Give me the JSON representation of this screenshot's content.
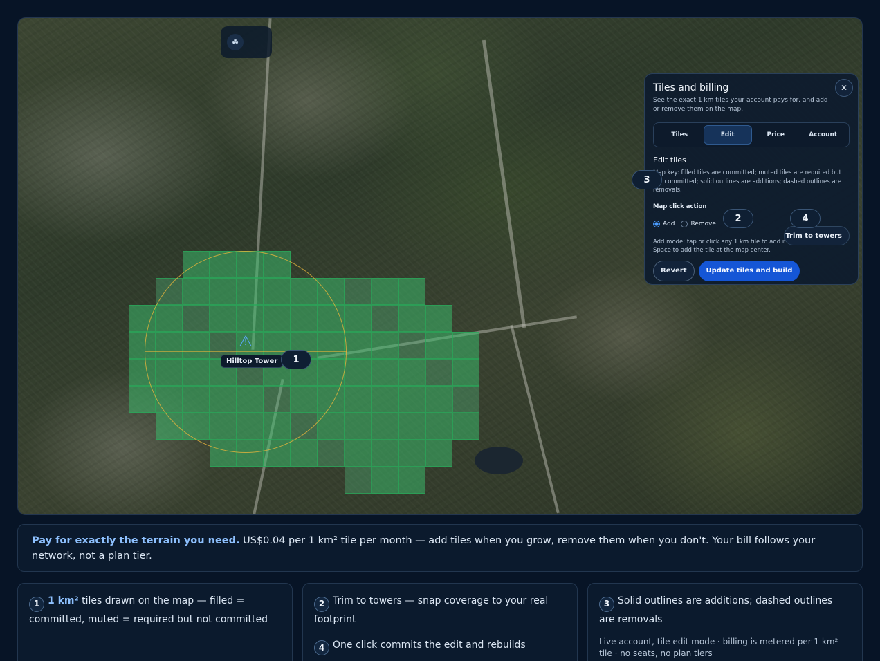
{
  "map": {
    "tower_label": "Hilltop Tower",
    "badges": [
      "1",
      "2",
      "3",
      "4"
    ]
  },
  "panel": {
    "title": "Tiles and billing",
    "subtitle": "See the exact 1 km tiles your account pays for, and add or remove them on the map.",
    "close_icon": "close-icon",
    "tabs": [
      {
        "label": "Tiles",
        "active": false
      },
      {
        "label": "Edit",
        "active": true
      },
      {
        "label": "Price",
        "active": false
      },
      {
        "label": "Account",
        "active": false
      }
    ],
    "section_title": "Edit tiles",
    "map_key": "Map key: filled tiles are committed; muted tiles are required but not committed; solid outlines are additions; dashed outlines are removals.",
    "click_action_label": "Map click action",
    "radio_add": "Add",
    "radio_remove": "Remove",
    "trim_button": "Trim to towers",
    "add_mode_help": "Add mode: tap or click any 1 km tile to add it. Press Enter or Space to add the tile at the map center.",
    "revert_button": "Revert",
    "update_button": "Update tiles and build"
  },
  "pitch": {
    "strong": "Pay for exactly the terrain you need.",
    "rest": " US$0.04 per 1 km² tile per month — add tiles when you grow, remove them when you don't. Your bill follows your network, not a plan tier."
  },
  "cards": {
    "c1_num": "1",
    "c1_hl": "1 km²",
    "c1_text": " tiles drawn on the map — filled = committed, muted = required but not committed",
    "c2_num": "2",
    "c2_text": "Trim to towers — snap coverage to your real footprint",
    "c2b_num": "4",
    "c2b_text": "One click commits the edit and rebuilds",
    "c3_num": "3",
    "c3_text": "Solid outlines are additions; dashed outlines are removals",
    "c3_note": "Live account, tile edit mode · billing is metered per 1 km² tile · no seats, no plan tiers"
  },
  "colors": {
    "accent": "#1556d6",
    "tile_fill": "#3cbe6e",
    "coverage_ring": "#e6b43c"
  }
}
